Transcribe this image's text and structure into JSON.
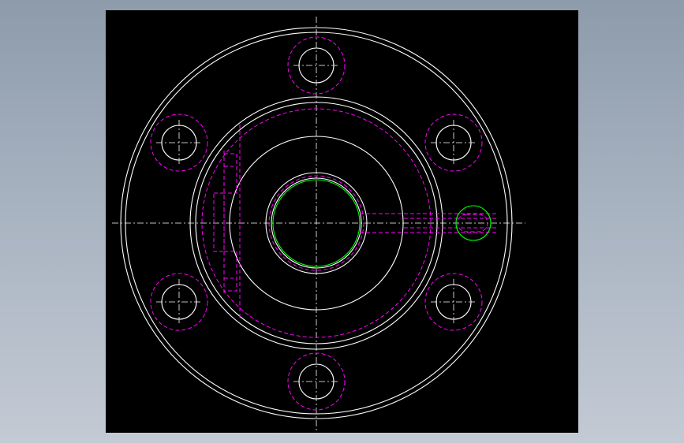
{
  "drawing": {
    "background_color": "#000000",
    "colors": {
      "solid_outline": "#ffffff",
      "hidden_line": "#ff00ff",
      "highlight": "#00ff00",
      "center_line": "#ffffff"
    },
    "bolt_holes": 6,
    "icons": [
      "flange-drawing"
    ]
  }
}
